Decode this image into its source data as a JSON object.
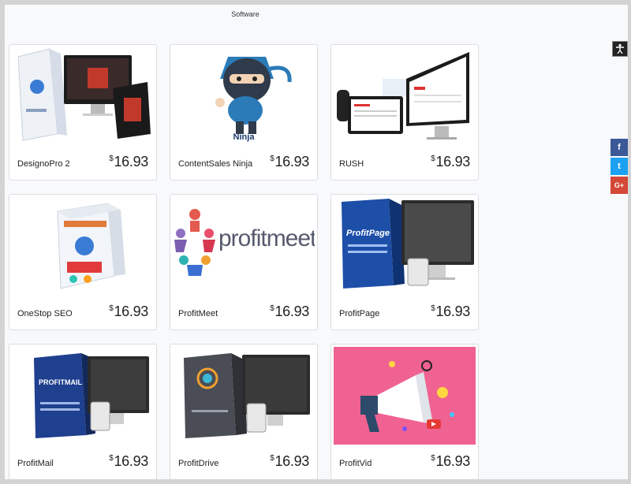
{
  "page": {
    "category_title": "Software"
  },
  "products": [
    {
      "name": "DesignoPro 2",
      "currency": "$",
      "price": "16.93"
    },
    {
      "name": "ContentSales Ninja",
      "currency": "$",
      "price": "16.93"
    },
    {
      "name": "RUSH",
      "currency": "$",
      "price": "16.93"
    },
    {
      "name": "OneStop SEO",
      "currency": "$",
      "price": "16.93"
    },
    {
      "name": "ProfitMeet",
      "currency": "$",
      "price": "16.93"
    },
    {
      "name": "ProfitPage",
      "currency": "$",
      "price": "16.93"
    },
    {
      "name": "ProfitMail",
      "currency": "$",
      "price": "16.93"
    },
    {
      "name": "ProfitDrive",
      "currency": "$",
      "price": "16.93"
    },
    {
      "name": "ProfitVid",
      "currency": "$",
      "price": "16.93"
    }
  ],
  "product_images": {
    "ninja_caption": "Ninja",
    "profitmeet_wordmark": "profitmeet",
    "profitpage_logo": "ProfitPage",
    "profitmail_logo": "PROFITMAIL"
  },
  "social": {
    "accessibility_icon": "accessibility-icon",
    "facebook": "f",
    "twitter": "t",
    "googleplus": "G+"
  },
  "colors": {
    "facebook": "#3b5998",
    "twitter": "#1da1f2",
    "googleplus": "#d34836",
    "profitvid_bg": "#f06292"
  }
}
